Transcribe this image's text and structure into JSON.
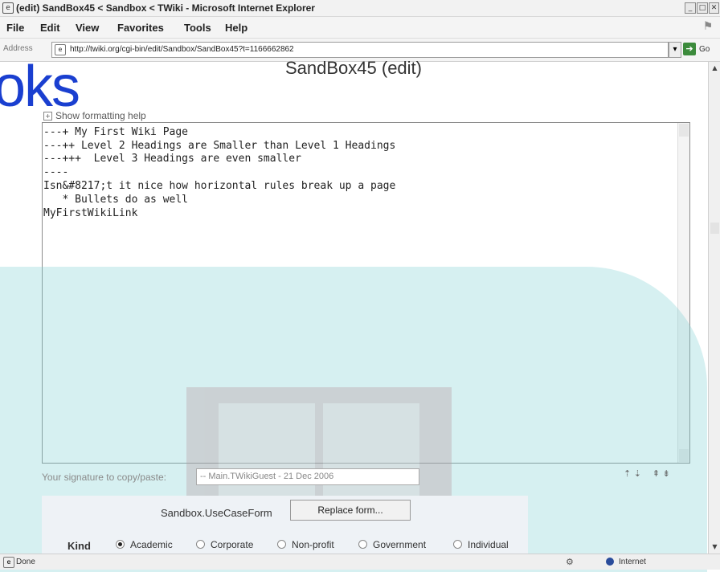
{
  "window": {
    "title": "(edit) SandBox45 < Sandbox < TWiki - Microsoft Internet Explorer",
    "buttons": {
      "minimize": "_",
      "maximize": "□",
      "close": "✕"
    }
  },
  "menu": {
    "items": [
      "File",
      "Edit",
      "View",
      "Favorites",
      "Tools",
      "Help"
    ]
  },
  "address": {
    "label": "Address",
    "url": "http://twiki.org/cgi-bin/edit/Sandbox/SandBox45?t=1166662862",
    "go_label": "Go"
  },
  "watermark": {
    "text": "oks",
    "logo_text": "PrepBooks"
  },
  "page": {
    "title": "SandBox45 (edit)",
    "help_toggle": "Show formatting help",
    "editor_lines": [
      "---+ My First Wiki Page",
      "---++ Level 2 Headings are Smaller than Level 1 Headings",
      "---+++  Level 3 Headings are even smaller",
      "----",
      "Isn&#8217;t it nice how horizontal rules break up a page",
      "   * Bullets do as well",
      "MyFirstWikiLink"
    ],
    "signature_label": "Your signature to copy/paste:",
    "signature_value": "-- Main.TWikiGuest - 21 Dec 2006",
    "form_name": "Sandbox.UseCaseForm",
    "replace_form_label": "Replace form...",
    "kind_label": "Kind",
    "kind_options": [
      {
        "label": "Academic",
        "selected": true
      },
      {
        "label": "Corporate",
        "selected": false
      },
      {
        "label": "Non-profit",
        "selected": false
      },
      {
        "label": "Government",
        "selected": false
      },
      {
        "label": "Individual",
        "selected": false
      }
    ]
  },
  "status": {
    "text": "Done",
    "zone": "Internet"
  },
  "colors": {
    "watermark_text": "#1a3fd0",
    "watermark_blob": "#7fd0d3"
  }
}
